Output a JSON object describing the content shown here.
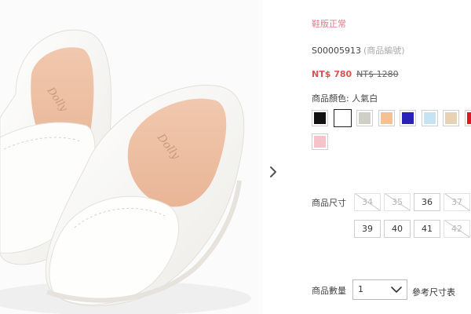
{
  "product": {
    "image_alt": "white leather loafers",
    "size_note": "鞋版正常",
    "sku": "S00005913",
    "sku_hint": "(商品編號)",
    "price_current": "NT$ 780",
    "price_original": "NT$ 1280"
  },
  "colors": {
    "label": "商品顏色: 人氣白",
    "swatches": [
      {
        "name": "black",
        "hex": "#111111",
        "selected": false
      },
      {
        "name": "white",
        "hex": "#ffffff",
        "selected": true
      },
      {
        "name": "light-grey",
        "hex": "#cfcfc8",
        "selected": false
      },
      {
        "name": "apricot",
        "hex": "#f6c192",
        "selected": false
      },
      {
        "name": "royal-blue",
        "hex": "#2a22b8",
        "selected": false
      },
      {
        "name": "light-blue",
        "hex": "#c7e3f1",
        "selected": false
      },
      {
        "name": "beige",
        "hex": "#e8d2b4",
        "selected": false
      },
      {
        "name": "red",
        "hex": "#e3161c",
        "selected": false
      },
      {
        "name": "pink",
        "hex": "#f7c3cb",
        "selected": false
      }
    ]
  },
  "sizes": {
    "label": "商品尺寸",
    "options": [
      {
        "value": "34",
        "available": false
      },
      {
        "value": "35",
        "available": false
      },
      {
        "value": "36",
        "available": true
      },
      {
        "value": "37",
        "available": false
      },
      {
        "value": "39",
        "available": true
      },
      {
        "value": "40",
        "available": true
      },
      {
        "value": "41",
        "available": true
      },
      {
        "value": "42",
        "available": false
      }
    ]
  },
  "quantity": {
    "label": "商品數量",
    "value": "1",
    "size_chart_link": "參考尺寸表"
  },
  "icons": {
    "next": "chevron-right-icon",
    "dropdown": "chevron-down-icon"
  }
}
